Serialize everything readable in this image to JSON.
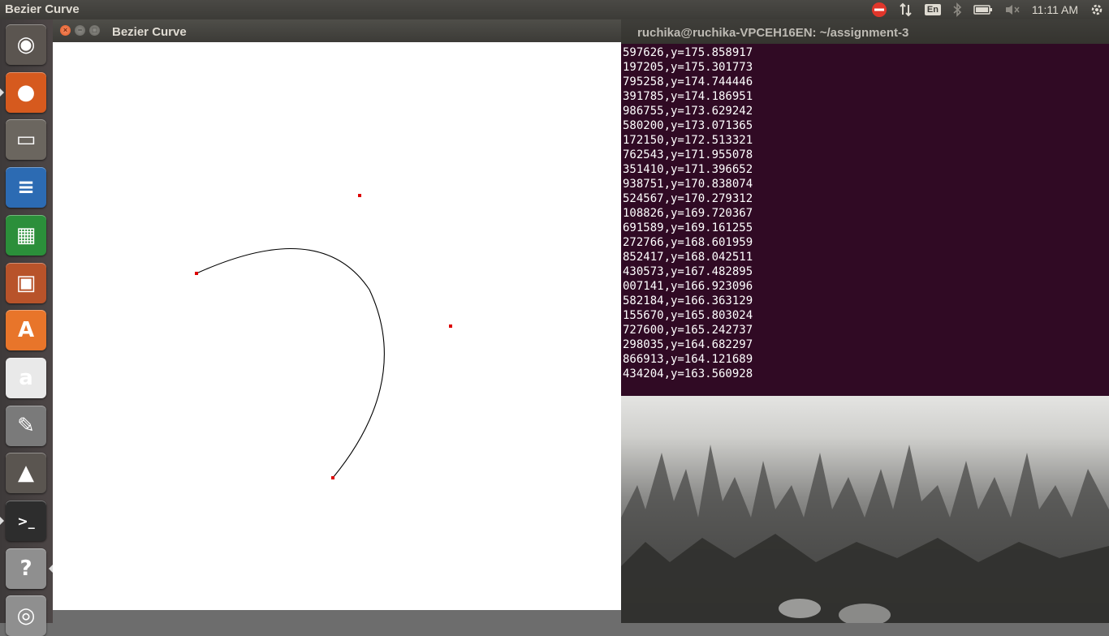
{
  "top_panel": {
    "app_title": "Bezier Curve",
    "language": "En",
    "clock": "11:11 AM"
  },
  "launcher": {
    "items": [
      {
        "name": "ubuntu-dash-icon",
        "glyph": "◉",
        "bg": "#5b5550"
      },
      {
        "name": "firefox-icon",
        "glyph": "●",
        "bg": "#d65a1e"
      },
      {
        "name": "files-icon",
        "glyph": "▭",
        "bg": "#6b665f"
      },
      {
        "name": "writer-icon",
        "glyph": "≡",
        "bg": "#2c6bb3"
      },
      {
        "name": "calc-icon",
        "glyph": "▦",
        "bg": "#2b8f3a"
      },
      {
        "name": "impress-icon",
        "glyph": "▣",
        "bg": "#b8532a"
      },
      {
        "name": "software-center-icon",
        "glyph": "A",
        "bg": "#e8752a"
      },
      {
        "name": "amazon-icon",
        "glyph": "a",
        "bg": "#e9e9e9"
      },
      {
        "name": "system-settings-icon",
        "glyph": "✎",
        "bg": "#7a7a7a"
      },
      {
        "name": "vlc-icon",
        "glyph": "▲",
        "bg": "#5a5550"
      },
      {
        "name": "terminal-icon",
        "glyph": ">_",
        "bg": "#2d2d2d"
      },
      {
        "name": "unknown-app-icon",
        "glyph": "?",
        "bg": "#8f8f8f"
      },
      {
        "name": "dvd-icon",
        "glyph": "◎",
        "bg": "#8f8f8f"
      }
    ]
  },
  "bezier_window": {
    "title": "Bezier Curve"
  },
  "terminal": {
    "title": "ruchika@ruchika-VPCEH16EN: ~/assignment-3",
    "lines": [
      "597626,y=175.858917",
      "197205,y=175.301773",
      "795258,y=174.744446",
      "391785,y=174.186951",
      "986755,y=173.629242",
      "580200,y=173.071365",
      "172150,y=172.513321",
      "762543,y=171.955078",
      "351410,y=171.396652",
      "938751,y=170.838074",
      "524567,y=170.279312",
      "108826,y=169.720367",
      "691589,y=169.161255",
      "272766,y=168.601959",
      "852417,y=168.042511",
      "430573,y=167.482895",
      "007141,y=166.923096",
      "582184,y=166.363129",
      "155670,y=165.803024",
      "727600,y=165.242737",
      "298035,y=164.682297",
      "866913,y=164.121689",
      "434204,y=163.560928"
    ]
  },
  "colors": {
    "control_point": "#dd0000",
    "curve": "#000000",
    "terminal_bg": "#300a24"
  }
}
